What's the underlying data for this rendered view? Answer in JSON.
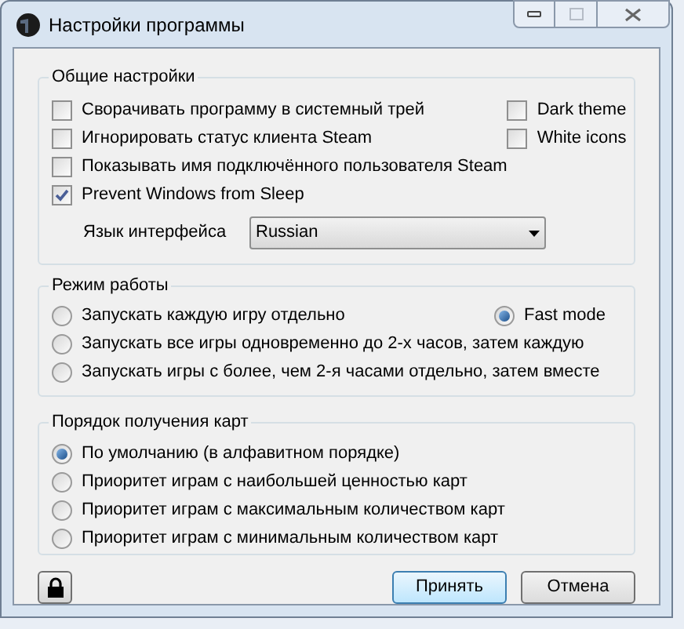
{
  "window": {
    "title": "Настройки программы",
    "maximize_disabled": true
  },
  "general": {
    "title": "Общие настройки",
    "options": [
      {
        "label": "Сворачивать программу в системный трей",
        "checked": false
      },
      {
        "label": "Игнорировать статус клиента Steam",
        "checked": false
      },
      {
        "label": "Показывать имя подключённого пользователя Steam",
        "checked": false
      },
      {
        "label": "Prevent Windows from Sleep",
        "checked": true
      }
    ],
    "side_options": [
      {
        "label": "Dark theme",
        "checked": false
      },
      {
        "label": "White icons",
        "checked": false
      }
    ],
    "language": {
      "label": "Язык интерфейса",
      "value": "Russian"
    }
  },
  "mode": {
    "title": "Режим работы",
    "options": [
      {
        "label": "Запускать каждую игру отдельно",
        "selected": false
      },
      {
        "label": "Fast mode",
        "selected": true
      },
      {
        "label": "Запускать все игры одновременно до 2-х часов, затем каждую",
        "selected": false
      },
      {
        "label": "Запускать игры с более, чем 2-я часами отдельно, затем вместе",
        "selected": false
      }
    ]
  },
  "order": {
    "title": "Порядок получения карт",
    "options": [
      {
        "label": "По умолчанию (в алфавитном порядке)",
        "selected": true
      },
      {
        "label": "Приоритет играм с наибольшей ценностью карт",
        "selected": false
      },
      {
        "label": "Приоритет играм с максимальным количеством карт",
        "selected": false
      },
      {
        "label": "Приоритет играм с минимальным количеством карт",
        "selected": false
      }
    ]
  },
  "buttons": [
    {
      "label": "Принять",
      "default": true
    },
    {
      "label": "Отмена",
      "default": false
    }
  ]
}
